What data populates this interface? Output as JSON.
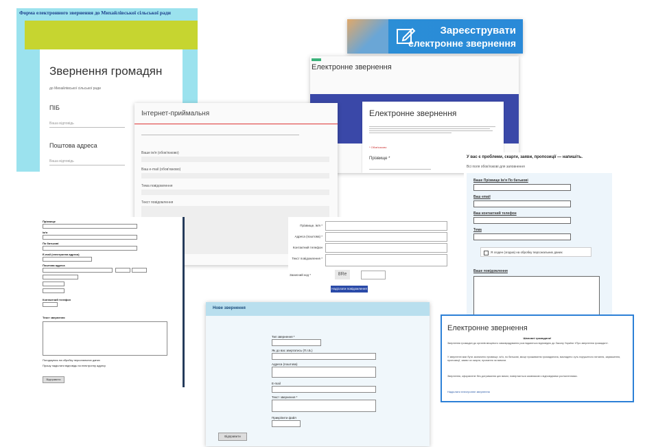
{
  "card1": {
    "header": "Форма електронного звернення до Михайлівської сільської ради",
    "title": "Звернення громадян",
    "subtitle": "до Михайлівської сільської ради",
    "field1": "ПІБ",
    "field1_placeholder": "Ваша відповідь",
    "field2": "Поштова адреса",
    "field2_placeholder": "Ваша відповідь"
  },
  "banner": {
    "line1": "Зареєструвати",
    "line2": "електронне звернення"
  },
  "card2": {
    "title": "Інтернет-приймальня",
    "fields": [
      "Ваше ім'я (обов'язково)",
      "Ваш e-mail (обов'язково)",
      "Тема повідомлення",
      "Текст повідомлення"
    ]
  },
  "card3": {
    "header_title": "Електронне звернення",
    "form_title": "Електронне звернення",
    "required": "* Обов'язково",
    "field_label": "Прізвище *"
  },
  "form_panel": {
    "rows": [
      "Прізвище, ім'я *",
      "Адреса (поштова) *",
      "Контактний телефон",
      "Текст повідомлення *"
    ],
    "captcha_label": "Захисний код *",
    "captcha_text": "8Re",
    "submit": "Надіслати повідомлення"
  },
  "card4": {
    "question": "У вас є проблеми, скарги, заяви, пропозиції — напишіть.",
    "hint": "Всі поля обов'язкові для заповнення",
    "fields": [
      "Ваше Прізвище Ім'я По батькові",
      "Ваш email",
      "Ваш контактний телефон",
      "Тема"
    ],
    "consent": "Я згоден (згодна) на обробку персональних даних",
    "message": "Ваше повідомлення"
  },
  "card5": {
    "fields": [
      "Прізвище",
      "Ім'я",
      "По батькові",
      "E-mail (електронна адреса)",
      "Поштова адреса",
      "Контактний телефон"
    ],
    "message_label": "Текст звернення",
    "check1": "Погоджуюсь на обробку персональних даних",
    "check2": "Прошу надіслати відповідь на електронну адресу",
    "submit": "Відправити"
  },
  "card6": {
    "header": "Нове звернення",
    "fields": [
      "Тип звернення *",
      "Як до вас звертатись (П.І.Б.)",
      "Адреса (поштова)",
      "E-mail",
      "Текст звернення *",
      "Прикріпити файл"
    ],
    "submit": "Відправити"
  },
  "card7": {
    "title": "Електронне звернення",
    "subtitle": "Шановні громадяни!",
    "paragraphs": [
      "Звернення громадян до органів місцевого самоврядування розглядаються відповідно до Закону України «Про звернення громадян».",
      "У зверненні має бути зазначено прізвище, ім'я, по батькові, місце проживання громадянина, викладено суть порушеного питання, зауваження, пропозиції, заяви чи скарги, прохання чи вимоги.",
      "Звернення, оформлене без дотримання цих вимог, повертається заявникові з відповідними роз'ясненнями."
    ],
    "link": "Надіслати електронне звернення"
  }
}
